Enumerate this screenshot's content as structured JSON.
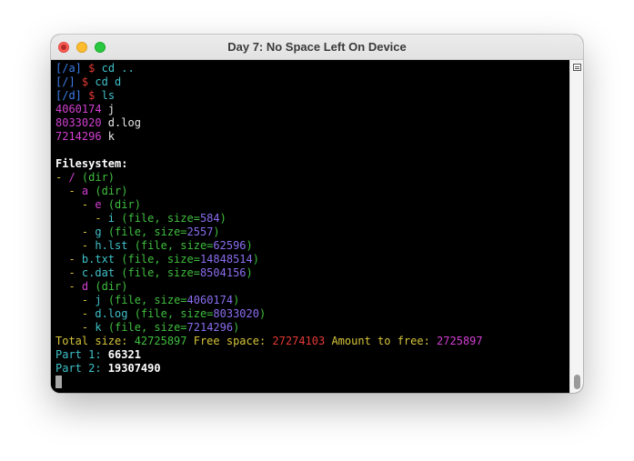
{
  "window": {
    "title": "Day 7: No Space Left On Device"
  },
  "colors": {
    "default": "#e8e8e8",
    "blue": "#3c7ee8",
    "red": "#e53935",
    "cyan": "#3fc1c9",
    "magenta": "#d23fd2",
    "green": "#3fbf3f",
    "yellow": "#d7c43a",
    "violet": "#8a6ef0",
    "white": "#ffffff"
  },
  "terminal": {
    "lines": [
      [
        [
          "[/a]",
          "blue"
        ],
        [
          " $ ",
          "red"
        ],
        [
          "cd ..",
          "cyan"
        ]
      ],
      [
        [
          "[/]",
          "blue"
        ],
        [
          " $ ",
          "red"
        ],
        [
          "cd d",
          "cyan"
        ]
      ],
      [
        [
          "[/d]",
          "blue"
        ],
        [
          " $ ",
          "red"
        ],
        [
          "ls",
          "cyan"
        ]
      ],
      [
        [
          "4060174",
          "magenta"
        ],
        [
          " j",
          "default"
        ]
      ],
      [
        [
          "8033020",
          "magenta"
        ],
        [
          " d.log",
          "default"
        ]
      ],
      [
        [
          "7214296",
          "magenta"
        ],
        [
          " k",
          "default"
        ]
      ],
      [],
      [
        [
          "Filesystem:",
          "white",
          "bold"
        ]
      ],
      [
        [
          "- ",
          "yellow"
        ],
        [
          "/",
          "magenta"
        ],
        [
          " (dir)",
          "green"
        ]
      ],
      [
        [
          "  - ",
          "yellow"
        ],
        [
          "a",
          "magenta"
        ],
        [
          " (dir)",
          "green"
        ]
      ],
      [
        [
          "    - ",
          "yellow"
        ],
        [
          "e",
          "magenta"
        ],
        [
          " (dir)",
          "green"
        ]
      ],
      [
        [
          "      - ",
          "yellow"
        ],
        [
          "i",
          "cyan"
        ],
        [
          " (file, size=",
          "green"
        ],
        [
          "584",
          "violet"
        ],
        [
          ")",
          "green"
        ]
      ],
      [
        [
          "    - ",
          "yellow"
        ],
        [
          "g",
          "cyan"
        ],
        [
          " (file, size=",
          "green"
        ],
        [
          "2557",
          "violet"
        ],
        [
          ")",
          "green"
        ]
      ],
      [
        [
          "    - ",
          "yellow"
        ],
        [
          "h.lst",
          "cyan"
        ],
        [
          " (file, size=",
          "green"
        ],
        [
          "62596",
          "violet"
        ],
        [
          ")",
          "green"
        ]
      ],
      [
        [
          "  - ",
          "yellow"
        ],
        [
          "b.txt",
          "cyan"
        ],
        [
          " (file, size=",
          "green"
        ],
        [
          "14848514",
          "violet"
        ],
        [
          ")",
          "green"
        ]
      ],
      [
        [
          "  - ",
          "yellow"
        ],
        [
          "c.dat",
          "cyan"
        ],
        [
          " (file, size=",
          "green"
        ],
        [
          "8504156",
          "violet"
        ],
        [
          ")",
          "green"
        ]
      ],
      [
        [
          "  - ",
          "yellow"
        ],
        [
          "d",
          "magenta"
        ],
        [
          " (dir)",
          "green"
        ]
      ],
      [
        [
          "    - ",
          "yellow"
        ],
        [
          "j",
          "cyan"
        ],
        [
          " (file, size=",
          "green"
        ],
        [
          "4060174",
          "violet"
        ],
        [
          ")",
          "green"
        ]
      ],
      [
        [
          "    - ",
          "yellow"
        ],
        [
          "d.log",
          "cyan"
        ],
        [
          " (file, size=",
          "green"
        ],
        [
          "8033020",
          "violet"
        ],
        [
          ")",
          "green"
        ]
      ],
      [
        [
          "    - ",
          "yellow"
        ],
        [
          "k",
          "cyan"
        ],
        [
          " (file, size=",
          "green"
        ],
        [
          "7214296",
          "violet"
        ],
        [
          ")",
          "green"
        ]
      ],
      [
        [
          "Total size: ",
          "yellow"
        ],
        [
          "42725897",
          "green"
        ],
        [
          " Free space: ",
          "yellow"
        ],
        [
          "27274103",
          "red"
        ],
        [
          " Amount to free: ",
          "yellow"
        ],
        [
          "2725897",
          "magenta"
        ]
      ],
      [
        [
          "Part 1: ",
          "cyan"
        ],
        [
          "66321",
          "white",
          "bold"
        ]
      ],
      [
        [
          "Part 2: ",
          "cyan"
        ],
        [
          "19307490",
          "white",
          "bold"
        ]
      ]
    ]
  },
  "scrollbar": {
    "position": 0.98
  }
}
